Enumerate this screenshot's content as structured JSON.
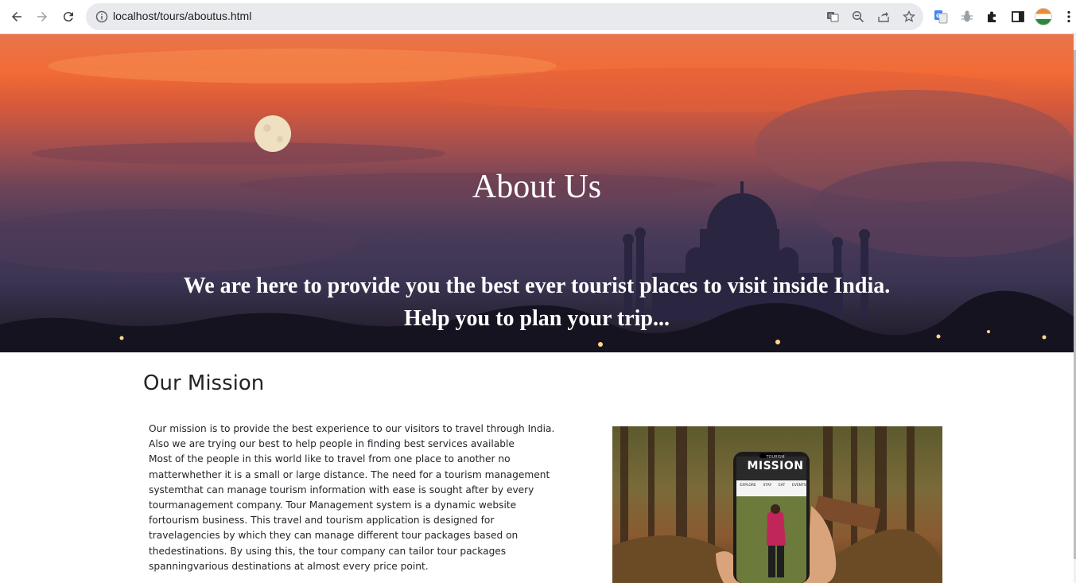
{
  "browser": {
    "url": "localhost/tours/aboutus.html",
    "colors": {
      "chrome_bg": "#ffffff",
      "omnibox_bg": "#e8eaed"
    }
  },
  "hero": {
    "title": "About Us",
    "subtitle_line1": "We are here to provide you the best ever tourist places to visit inside India.",
    "subtitle_line2": "Help you to plan your trip..."
  },
  "mission": {
    "heading": "Our Mission",
    "paragraph1": "Our mission is to provide the best experience to our visitors to travel through India. Also we are trying our best to help people in finding best services available",
    "paragraph2": "Most of the people in this world like to travel from one place to another no matterwhether it is a small or large distance. The need for a tourism management systemthat can manage tourism information with ease is sought after by every tourmanagement company. Tour Management system is a dynamic website fortourism business. This travel and tourism application is designed for travelagencies by which they can manage different tour packages based on thedestinations. By using this, the tour company can tailor tour packages spanningvarious destinations at almost every price point.",
    "image": {
      "small_text": "TOURISM",
      "caption": "MISSION",
      "tabs": [
        "EXPLORE",
        "STAY",
        "EAT",
        "EVENTS"
      ]
    }
  }
}
